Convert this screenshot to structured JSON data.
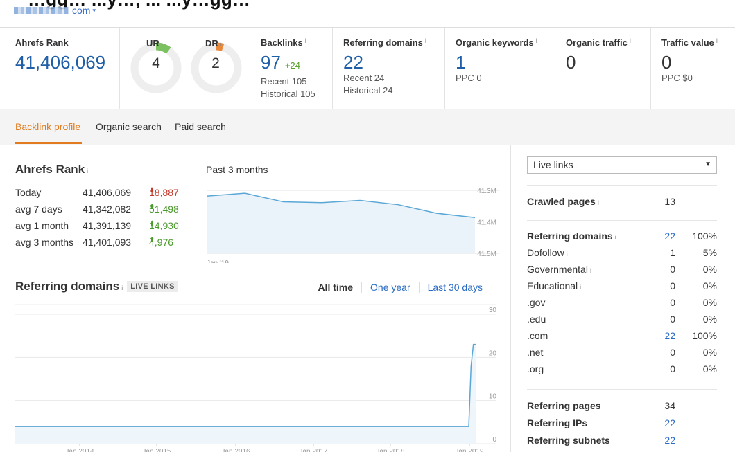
{
  "header": {
    "page_title_fragment": "…gg… ...y…, ... ...y…gg…",
    "domain_suffix": "com",
    "domain_caret": "▾"
  },
  "metrics": {
    "ahrefs_rank": {
      "label": "Ahrefs Rank",
      "value": "41,406,069"
    },
    "ur": {
      "label": "UR",
      "value": "4",
      "color": "#7cc160",
      "score": 4
    },
    "dr": {
      "label": "DR",
      "value": "2",
      "color": "#e8893a",
      "score": 2
    },
    "backlinks": {
      "label": "Backlinks",
      "value": "97",
      "delta": "+24",
      "recent": "Recent 105",
      "historical": "Historical 105"
    },
    "referring_domains": {
      "label": "Referring domains",
      "value": "22",
      "recent": "Recent 24",
      "historical": "Historical 24"
    },
    "organic_keywords": {
      "label": "Organic keywords",
      "value": "1",
      "sub": "PPC 0"
    },
    "organic_traffic": {
      "label": "Organic traffic",
      "value": "0"
    },
    "traffic_value": {
      "label": "Traffic value",
      "value": "0",
      "sub": "PPC $0"
    }
  },
  "info_glyph": "i",
  "tabs": [
    {
      "label": "Backlink profile",
      "active": true
    },
    {
      "label": "Organic search",
      "active": false
    },
    {
      "label": "Paid search",
      "active": false
    }
  ],
  "rank_section": {
    "title": "Ahrefs Rank",
    "period_label": "Past 3 months",
    "rows": [
      {
        "label": "Today",
        "value": "41,406,069",
        "delta": "18,887",
        "dir": "down",
        "arrow": "⬇"
      },
      {
        "label": "avg 7 days",
        "value": "41,342,082",
        "delta": "51,498",
        "dir": "up",
        "arrow": "⬆"
      },
      {
        "label": "avg 1 month",
        "value": "41,391,139",
        "delta": "14,930",
        "dir": "up",
        "arrow": "⬆"
      },
      {
        "label": "avg 3 months",
        "value": "41,401,093",
        "delta": "4,976",
        "dir": "up",
        "arrow": "⬆"
      }
    ]
  },
  "rank_chart": {
    "chart_data": {
      "type": "area",
      "x": [
        "Jan '19",
        "",
        "",
        "",
        "",
        "",
        "",
        ""
      ],
      "values": [
        41.3,
        41.29,
        41.32,
        41.323,
        41.315,
        41.33,
        41.36,
        41.375
      ],
      "y_ticks": [
        "41.3M",
        "41.4M",
        "41.5M"
      ],
      "ylim": [
        41.28,
        41.5
      ],
      "x_label_first": "Jan '19",
      "inverted": true,
      "color": "#5aa7d6"
    }
  },
  "refdomains_section": {
    "title": "Referring domains",
    "badge": "LIVE LINKS",
    "filters": [
      {
        "label": "All time",
        "active": true
      },
      {
        "label": "One year",
        "active": false
      },
      {
        "label": "Last 30 days",
        "active": false
      }
    ]
  },
  "refdomains_chart": {
    "chart_data": {
      "type": "line",
      "x_ticks": [
        "Jan 2014",
        "Jan 2015",
        "Jan 2016",
        "Jan 2017",
        "Jan 2018",
        "Jan 2019"
      ],
      "y_ticks": [
        "30",
        "20",
        "10",
        "0"
      ],
      "ylim": [
        0,
        30
      ],
      "description_points": [
        [
          0,
          4
        ],
        [
          0.985,
          4
        ],
        [
          0.99,
          18
        ],
        [
          0.995,
          23
        ],
        [
          1.0,
          23
        ]
      ],
      "color": "#5aa7d6"
    }
  },
  "right_panel": {
    "select_label": "Live links",
    "select_caret": "▼",
    "stats": [
      {
        "label": "Crawled pages",
        "value": "13",
        "pct": "",
        "bold": true,
        "link": false
      },
      {
        "label": "Referring domains",
        "value": "22",
        "pct": "100%",
        "bold": true,
        "link": true
      },
      {
        "label": "Dofollow",
        "value": "1",
        "pct": "5%",
        "bold": false,
        "link": false
      },
      {
        "label": "Governmental",
        "value": "0",
        "pct": "0%",
        "bold": false,
        "link": false
      },
      {
        "label": "Educational",
        "value": "0",
        "pct": "0%",
        "bold": false,
        "link": false
      },
      {
        "label": ".gov",
        "value": "0",
        "pct": "0%",
        "bold": false,
        "link": false
      },
      {
        "label": ".edu",
        "value": "0",
        "pct": "0%",
        "bold": false,
        "link": false
      },
      {
        "label": ".com",
        "value": "22",
        "pct": "100%",
        "bold": false,
        "link": true
      },
      {
        "label": ".net",
        "value": "0",
        "pct": "0%",
        "bold": false,
        "link": false
      },
      {
        "label": ".org",
        "value": "0",
        "pct": "0%",
        "bold": false,
        "link": false
      },
      {
        "label": "Referring pages",
        "value": "34",
        "pct": "",
        "bold": true,
        "link": false
      },
      {
        "label": "Referring IPs",
        "value": "22",
        "pct": "",
        "bold": true,
        "link": true
      },
      {
        "label": "Referring subnets",
        "value": "22",
        "pct": "",
        "bold": true,
        "link": true
      }
    ]
  }
}
